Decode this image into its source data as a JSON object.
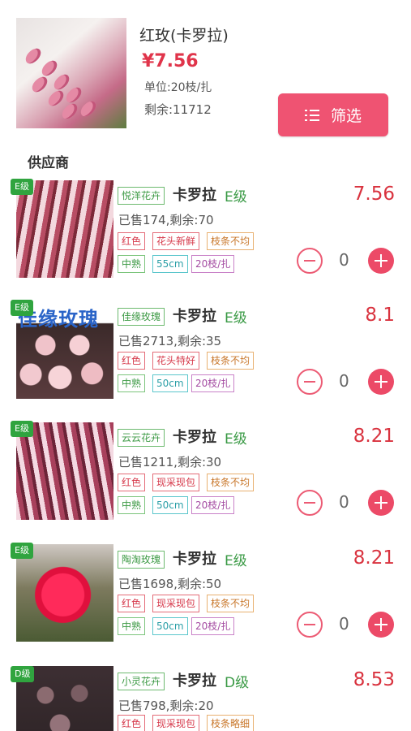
{
  "product": {
    "name": "红玫(卡罗拉)",
    "price": "¥7.56",
    "unit": "单位:20枝/扎",
    "stock": "剩余:11712"
  },
  "filter": {
    "label": "筛选",
    "icon": "list-icon"
  },
  "section_title": "供应商",
  "suppliers": [
    {
      "badge": "E级",
      "shop": "悦洋花卉",
      "variety": "卡罗拉",
      "grade": "E级",
      "sold": "已售174,剩余:70",
      "tags_row1": [
        "红色",
        "花头新鲜",
        "枝条不均"
      ],
      "tags_row2": [
        "中熟",
        "55cm",
        "20枝/扎"
      ],
      "price": "7.56",
      "qty": "0"
    },
    {
      "badge": "E级",
      "shop": "佳缘玫瑰",
      "variety": "卡罗拉",
      "grade": "E级",
      "sold": "已售2713,剩余:35",
      "watermark": "佳缘玫瑰",
      "tags_row1": [
        "红色",
        "花头特好",
        "枝条不均"
      ],
      "tags_row2": [
        "中熟",
        "50cm",
        "20枝/扎"
      ],
      "price": "8.1",
      "qty": "0"
    },
    {
      "badge": "E级",
      "shop": "云云花卉",
      "variety": "卡罗拉",
      "grade": "E级",
      "sold": "已售1211,剩余:30",
      "tags_row1": [
        "红色",
        "现采现包",
        "枝条不均"
      ],
      "tags_row2": [
        "中熟",
        "50cm",
        "20枝/扎"
      ],
      "price": "8.21",
      "qty": "0"
    },
    {
      "badge": "E级",
      "shop": "陶淘玫瑰",
      "variety": "卡罗拉",
      "grade": "E级",
      "sold": "已售1698,剩余:50",
      "tags_row1": [
        "红色",
        "现采现包",
        "枝条不均"
      ],
      "tags_row2": [
        "中熟",
        "50cm",
        "20枝/扎"
      ],
      "price": "8.21",
      "qty": "0"
    },
    {
      "badge": "D级",
      "shop": "小灵花卉",
      "variety": "卡罗拉",
      "grade": "D级",
      "sold": "已售798,剩余:20",
      "tags_row1": [
        "红色",
        "现采现包",
        "枝条略细"
      ],
      "price": "8.53"
    }
  ],
  "colors": {
    "accent": "#ef5372",
    "price_red": "#d9333f",
    "grade_green": "#30a43f"
  }
}
